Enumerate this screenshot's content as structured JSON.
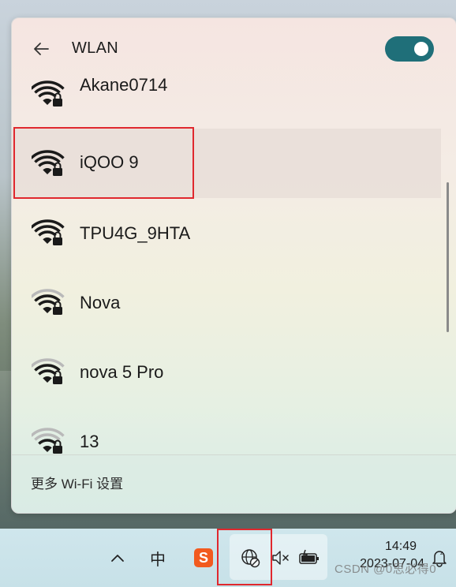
{
  "flyout": {
    "title": "WLAN",
    "wifi_enabled": true,
    "networks": [
      {
        "name": "Akane0714",
        "signal_bars": 4,
        "secured": true,
        "selected": false
      },
      {
        "name": "iQOO 9",
        "signal_bars": 4,
        "secured": true,
        "selected": true
      },
      {
        "name": "TPU4G_9HTA",
        "signal_bars": 4,
        "secured": true,
        "selected": false
      },
      {
        "name": "Nova",
        "signal_bars": 3,
        "secured": true,
        "selected": false
      },
      {
        "name": "nova 5 Pro",
        "signal_bars": 3,
        "secured": true,
        "selected": false
      },
      {
        "name": "13",
        "signal_bars": 2,
        "secured": true,
        "selected": false
      }
    ],
    "more_settings": "更多 Wi-Fi 设置"
  },
  "taskbar": {
    "show_hidden": "^",
    "ime": "中",
    "sogou": "S",
    "time": "14:49",
    "date": "2023-07-04"
  },
  "watermark": "CSDN @0思必得0",
  "colors": {
    "accent": "#1f6f79",
    "highlight": "#e0282e",
    "sogou": "#f25a1e"
  }
}
